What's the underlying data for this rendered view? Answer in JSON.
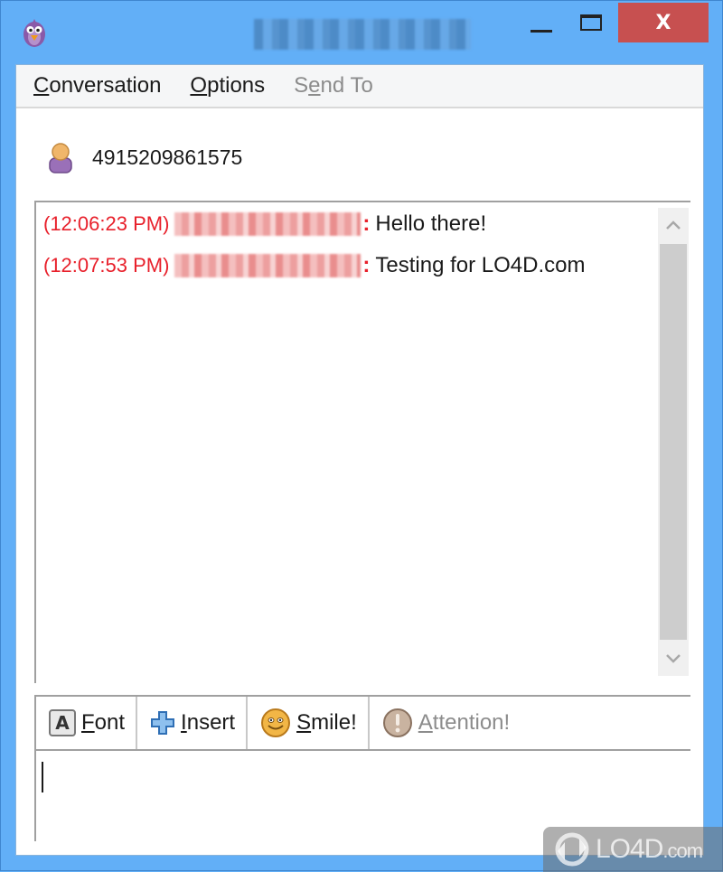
{
  "window": {
    "title": "4915209861575",
    "controls": {
      "minimize": "_",
      "maximize": "□",
      "close": "X"
    },
    "close_color": "#c75050",
    "frame_color": "#62aff7"
  },
  "menubar": {
    "items": [
      {
        "label": "Conversation",
        "accel": "C",
        "rest": "onversation",
        "enabled": true
      },
      {
        "label": "Options",
        "accel": "O",
        "rest": "ptions",
        "enabled": true
      },
      {
        "label": "Send To",
        "pre": "S",
        "accel": "e",
        "rest": "nd To",
        "enabled": false
      }
    ]
  },
  "contact": {
    "name": "4915209861575",
    "icon": "buddy-icon"
  },
  "chat": {
    "messages": [
      {
        "time": "(12:06:23 PM)",
        "sender": "[redacted]",
        "colon": ":",
        "text": "Hello there!"
      },
      {
        "time": "(12:07:53 PM)",
        "sender": "[redacted]",
        "colon": ":",
        "text": "Testing for LO4D.com"
      }
    ],
    "time_color": "#e8202b",
    "scroll_up": "^",
    "scroll_down": "v"
  },
  "toolbar": {
    "buttons": [
      {
        "label": "Font",
        "accel": "F",
        "rest": "ont",
        "icon": "font-icon",
        "glyph": "A",
        "enabled": true
      },
      {
        "label": "Insert",
        "accel": "I",
        "rest": "nsert",
        "icon": "plus-icon",
        "enabled": true
      },
      {
        "label": "Smile!",
        "accel": "S",
        "rest": "mile!",
        "icon": "smiley-icon",
        "enabled": true
      },
      {
        "label": "Attention!",
        "accel": "A",
        "rest": "ttention!",
        "icon": "attention-icon",
        "enabled": false
      }
    ]
  },
  "input": {
    "value": ""
  },
  "watermark": {
    "text": "LO4D",
    "suffix": ".com"
  }
}
